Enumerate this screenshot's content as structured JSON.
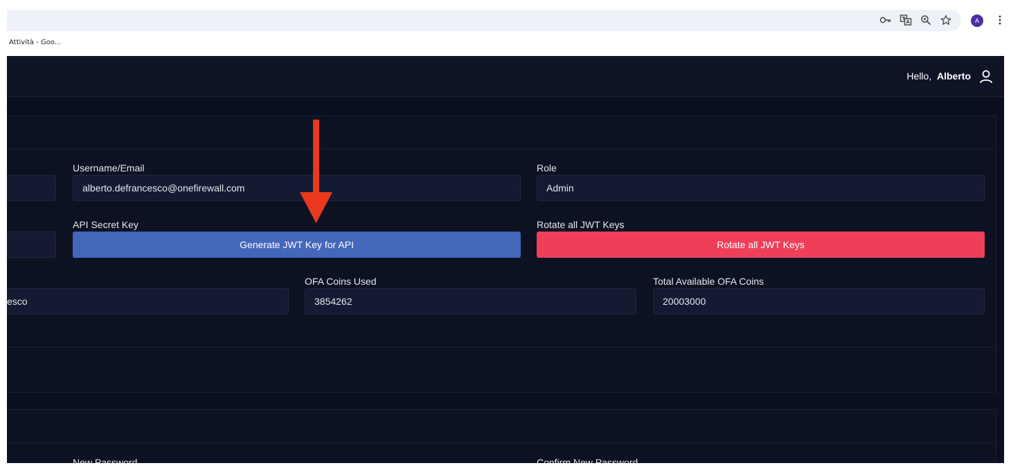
{
  "browser": {
    "bookmark": "Attività - Goo...",
    "avatar_letter": "A",
    "icons": [
      "key-icon",
      "translate-icon",
      "zoom-icon",
      "star-icon",
      "kebab-menu-icon"
    ]
  },
  "header": {
    "greeting": "Hello,",
    "user_name": "Alberto"
  },
  "account": {
    "username_label": "Username/Email",
    "username_value": "alberto.defrancesco@onefirewall.com",
    "role_label": "Role",
    "role_value": "Admin",
    "api_key_label": "API Secret Key",
    "generate_button": "Generate JWT Key for API",
    "rotate_label": "Rotate all JWT Keys",
    "rotate_button": "Rotate all JWT Keys",
    "surname_value_partial": "esco",
    "coins_used_label": "OFA Coins Used",
    "coins_used_value": "3854262",
    "coins_total_label": "Total Available OFA Coins",
    "coins_total_value": "20003000"
  },
  "password": {
    "new_label": "New Password",
    "confirm_label": "Confirm New Password"
  },
  "colors": {
    "primary_button": "#4466bb",
    "danger_button": "#ee3e5a",
    "annotation_arrow": "#e8391f",
    "background": "#0b1020"
  }
}
